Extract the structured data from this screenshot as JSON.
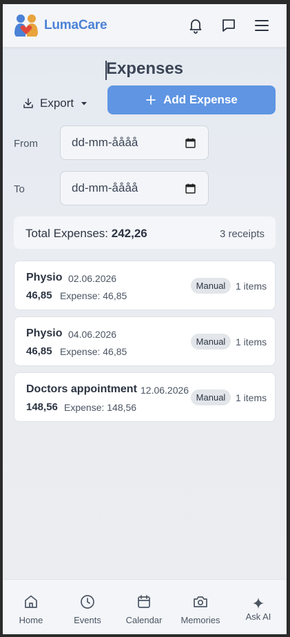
{
  "app": {
    "brand": "LumaCare",
    "header_icons": [
      "bell-icon",
      "chat-icon",
      "menu-icon"
    ],
    "accent": "#5f95e3",
    "brand_color": "#4c82d6"
  },
  "page": {
    "title": "Expenses",
    "export_label": "Export",
    "add_label": "Add Expense"
  },
  "filters": {
    "from_label": "From",
    "from_placeholder": "dd-mm-åååå",
    "to_label": "To",
    "to_placeholder": "dd-mm-åååå"
  },
  "summary": {
    "total_label": "Total Expenses:",
    "total_value": "242,26",
    "receipts": "3 receipts"
  },
  "expenses": [
    {
      "name": "Physio",
      "date": "02.06.2026",
      "amount": "46,85",
      "expense": "Expense: 46,85",
      "badge": "Manual",
      "items": "1 items"
    },
    {
      "name": "Physio",
      "date": "04.06.2026",
      "amount": "46,85",
      "expense": "Expense: 46,85",
      "badge": "Manual",
      "items": "1 items"
    },
    {
      "name": "Doctors appointment",
      "date": "12.06.2026",
      "amount": "148,56",
      "expense": "Expense: 148,56",
      "badge": "Manual",
      "items": "1 items"
    }
  ],
  "nav": [
    {
      "label": "Home",
      "icon": "home-icon"
    },
    {
      "label": "Events",
      "icon": "clock-icon"
    },
    {
      "label": "Calendar",
      "icon": "calendar-icon"
    },
    {
      "label": "Memories",
      "icon": "camera-icon"
    },
    {
      "label": "Ask AI",
      "icon": "sparkle-icon"
    }
  ]
}
